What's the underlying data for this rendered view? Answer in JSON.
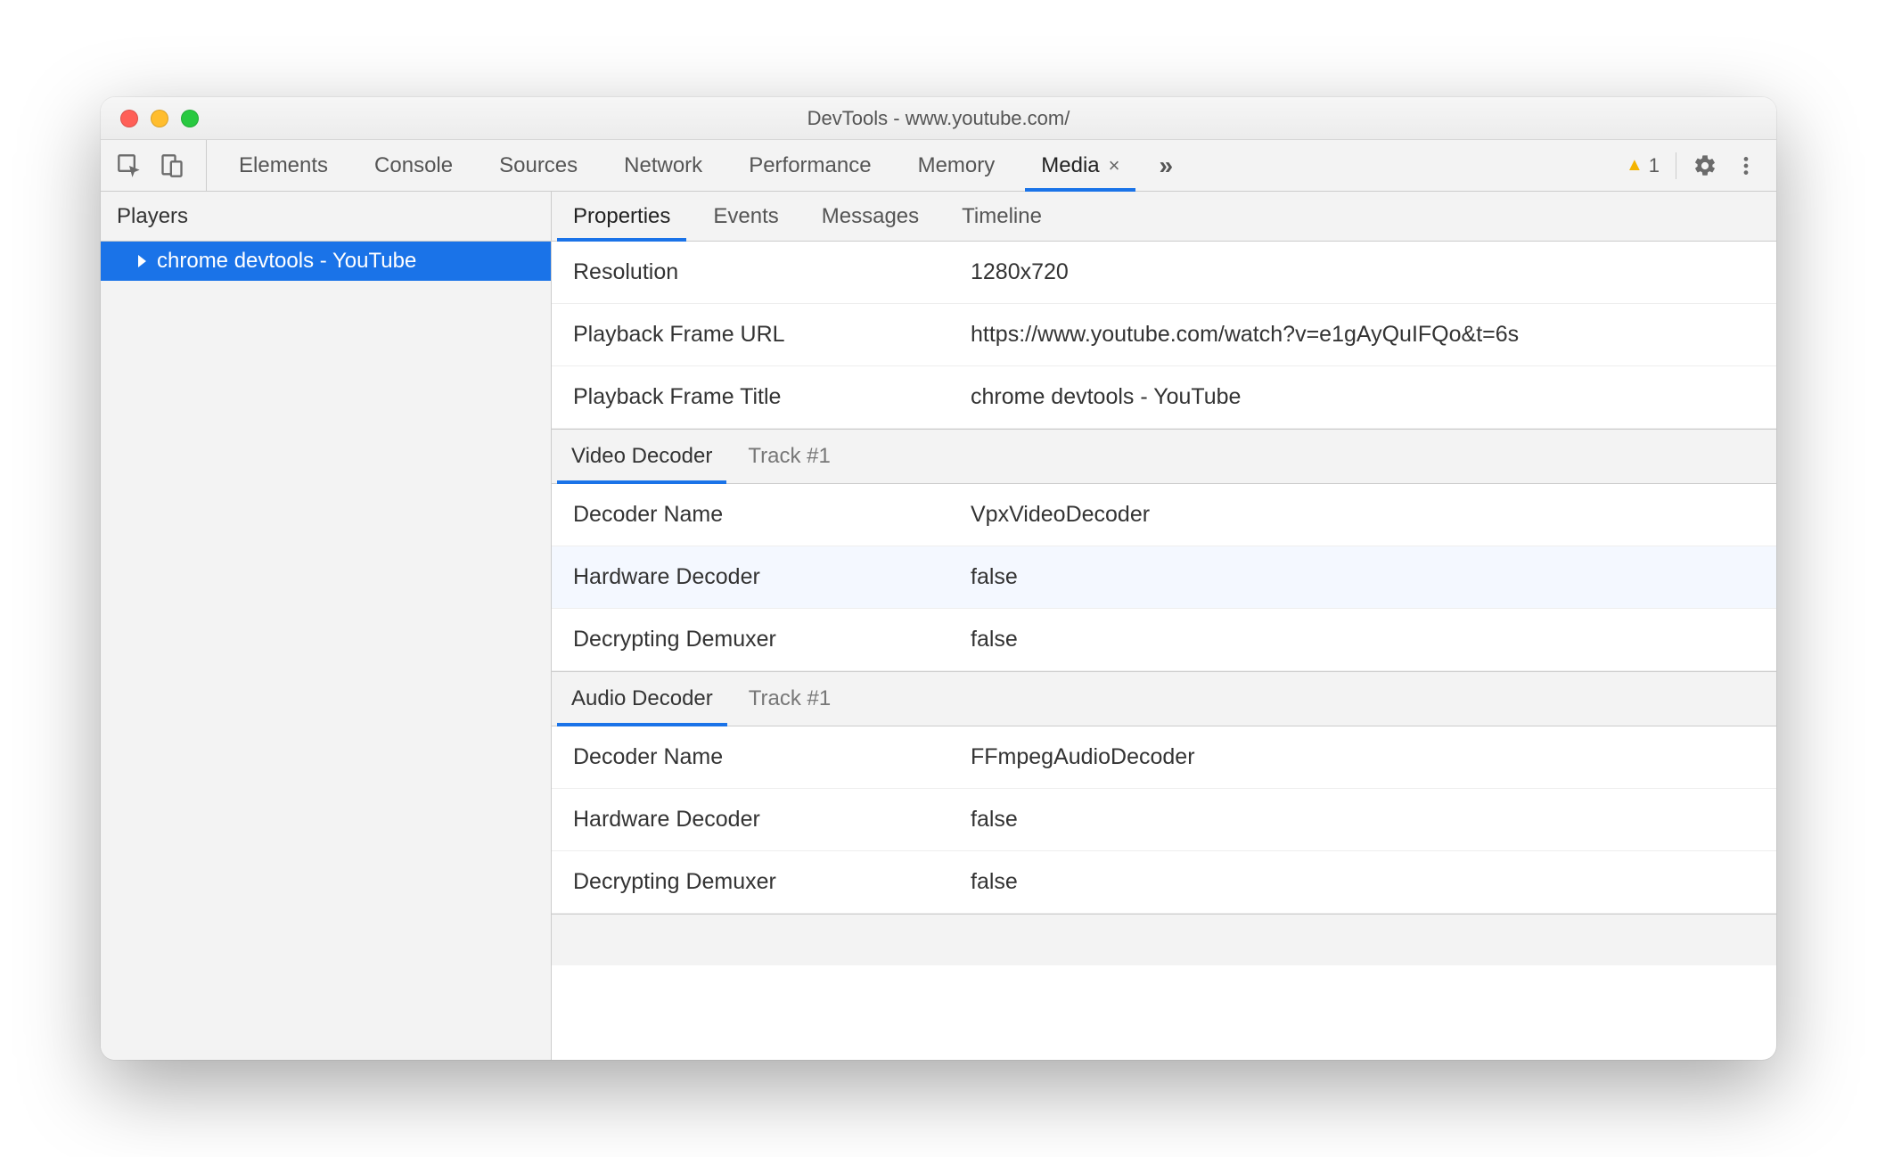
{
  "window": {
    "title": "DevTools - www.youtube.com/"
  },
  "toolbar": {
    "tabs": [
      {
        "label": "Elements"
      },
      {
        "label": "Console"
      },
      {
        "label": "Sources"
      },
      {
        "label": "Network"
      },
      {
        "label": "Performance"
      },
      {
        "label": "Memory"
      },
      {
        "label": "Media",
        "active": true,
        "closable": true
      }
    ],
    "warning_count": "1"
  },
  "sidebar": {
    "title": "Players",
    "items": [
      {
        "label": "chrome devtools - YouTube",
        "selected": true
      }
    ]
  },
  "subtabs": [
    {
      "label": "Properties",
      "active": true
    },
    {
      "label": "Events"
    },
    {
      "label": "Messages"
    },
    {
      "label": "Timeline"
    }
  ],
  "properties": {
    "top": [
      {
        "key": "Resolution",
        "value": "1280x720"
      },
      {
        "key": "Playback Frame URL",
        "value": "https://www.youtube.com/watch?v=e1gAyQuIFQo&t=6s"
      },
      {
        "key": "Playback Frame Title",
        "value": "chrome devtools - YouTube"
      }
    ],
    "sections": [
      {
        "label": "Video Decoder",
        "sublabel": "Track #1",
        "rows": [
          {
            "key": "Decoder Name",
            "value": "VpxVideoDecoder"
          },
          {
            "key": "Hardware Decoder",
            "value": "false",
            "tint": true
          },
          {
            "key": "Decrypting Demuxer",
            "value": "false"
          }
        ]
      },
      {
        "label": "Audio Decoder",
        "sublabel": "Track #1",
        "rows": [
          {
            "key": "Decoder Name",
            "value": "FFmpegAudioDecoder"
          },
          {
            "key": "Hardware Decoder",
            "value": "false"
          },
          {
            "key": "Decrypting Demuxer",
            "value": "false"
          }
        ]
      }
    ]
  }
}
